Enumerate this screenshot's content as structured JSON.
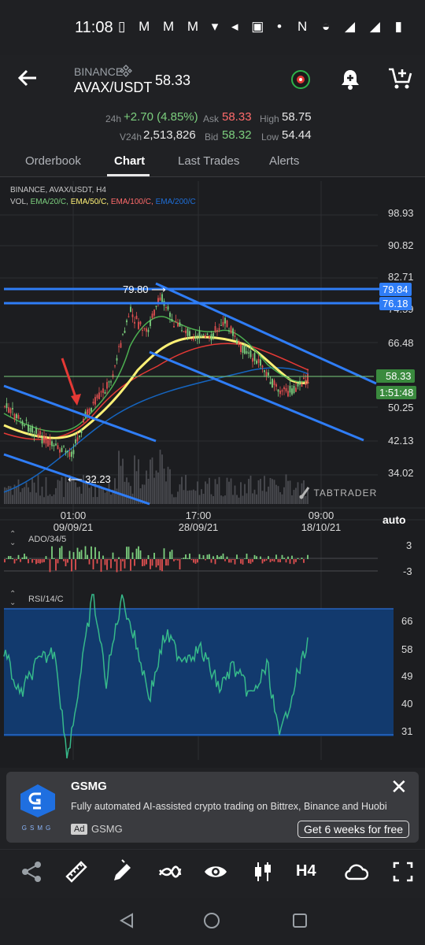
{
  "status_bar": {
    "time": "11:08",
    "left_icons": "▯ M M M ▾ ◂ ▣ •",
    "right_icons": "N ◒ ◢ ◢ ▮"
  },
  "header": {
    "exchange": "BINANCE",
    "pair": "AVAX/USDT",
    "price": "58.33",
    "change_label": "24h",
    "change": "+2.70 (4.85%)",
    "ask_label": "Ask",
    "ask": "58.33",
    "high_label": "High",
    "high": "58.75",
    "volume_label": "V24h",
    "volume": "2,513,826",
    "bid_label": "Bid",
    "bid": "58.32",
    "low_label": "Low",
    "low": "54.44"
  },
  "tabs": [
    {
      "label": "Orderbook"
    },
    {
      "label": "Chart"
    },
    {
      "label": "Last Trades"
    },
    {
      "label": "Alerts"
    }
  ],
  "chart": {
    "legend": {
      "line1": "BINANCE, AVAX/USDT, H4",
      "vol": "VOL,",
      "ema20": "EMA/20/C,",
      "ema50": "EMA/50/C,",
      "ema100": "EMA/100/C,",
      "ema200": "EMA/200/C"
    },
    "y_ticks": [
      "98.93",
      "90.82",
      "82.71",
      "74.59",
      "66.48",
      "50.25",
      "42.13",
      "34.02"
    ],
    "x_ticks": [
      {
        "time": "01:00",
        "date": "09/09/21"
      },
      {
        "time": "17:00",
        "date": "28/09/21"
      },
      {
        "time": "09:00",
        "date": "18/10/21"
      }
    ],
    "price_tags": {
      "line1": "79.84",
      "line2": "76.18",
      "last": "58.33",
      "countdown": "1:51:48"
    },
    "annotations": {
      "high": "79.80 ⟶",
      "low": "⟵ 32.23"
    },
    "watermark": "TABTRADER",
    "auto_label": "auto",
    "colors": {
      "ema20": "#4caf50",
      "ema50": "#fff176",
      "ema100": "#e53935",
      "ema200": "#1565c0",
      "trendline": "#2f7df6",
      "candle_up": "#7ccf7e",
      "candle_down": "#e05050"
    }
  },
  "ado": {
    "label": "ADO/34/5",
    "ticks": [
      "3",
      "-3"
    ]
  },
  "rsi": {
    "label": "RSI/14/C",
    "ticks": [
      "66",
      "58",
      "49",
      "40",
      "31"
    ]
  },
  "ad": {
    "title": "GSMG",
    "description": "Fully automated AI-assisted crypto trading on Bittrex, Binance and Huobi",
    "badge": "Ad",
    "source": "GSMG",
    "logo_text": "GSMG",
    "cta": "Get 6 weeks for free",
    "close": "✕"
  },
  "toolbar": {
    "icons": [
      "share-icon",
      "ruler-icon",
      "pencil-icon",
      "indicators-icon",
      "eye-icon",
      "candles-icon",
      "timeframe",
      "cloud-icon",
      "fullscreen-icon"
    ],
    "timeframe": "H4"
  }
}
